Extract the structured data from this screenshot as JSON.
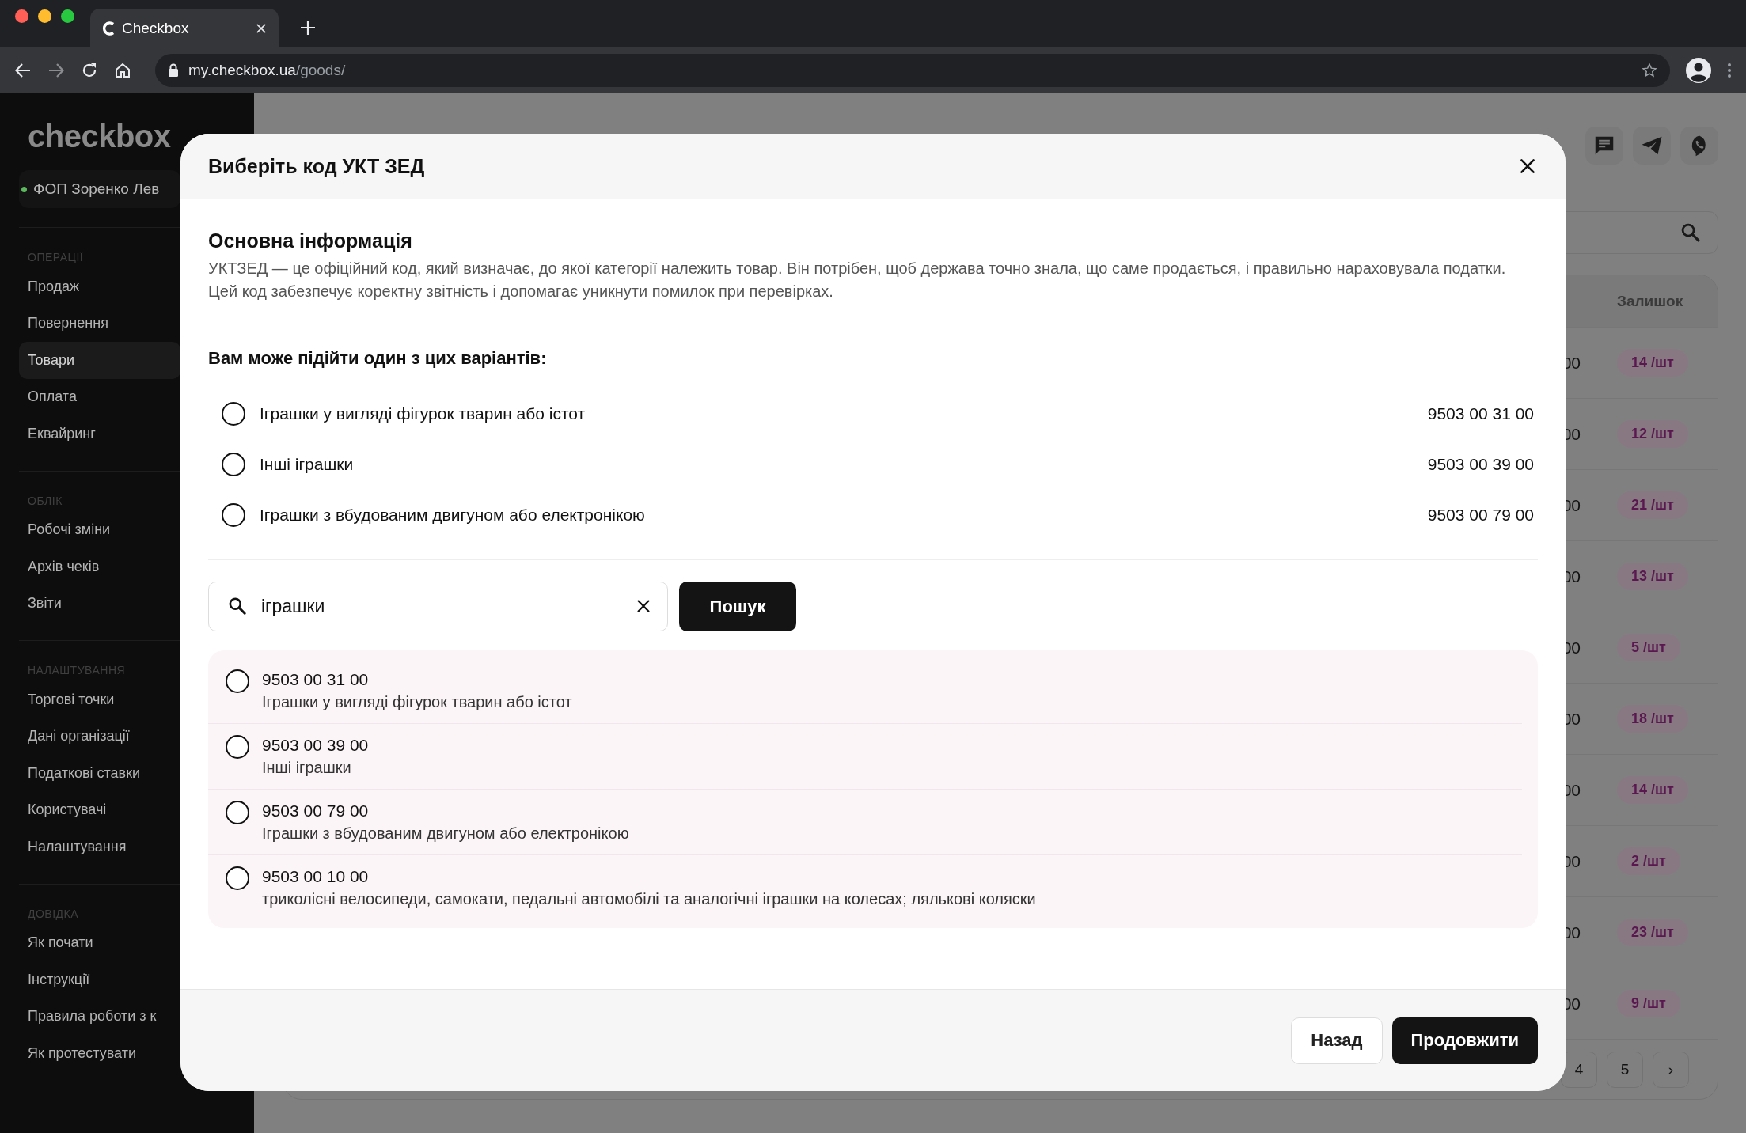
{
  "browser": {
    "tab_title": "Checkbox",
    "url_host": "my.checkbox.ua",
    "url_path": "/goods/"
  },
  "sidebar": {
    "logo": "checkbox",
    "organization": "ФОП Зоренко Лев",
    "sections": [
      {
        "title": "ОПЕРАЦІЇ",
        "items": [
          {
            "label": "Продаж",
            "selected": false
          },
          {
            "label": "Повернення",
            "selected": false
          },
          {
            "label": "Товари",
            "selected": true
          },
          {
            "label": "Оплата",
            "selected": false
          },
          {
            "label": "Еквайринг",
            "selected": false
          }
        ]
      },
      {
        "title": "ОБЛІК",
        "items": [
          {
            "label": "Робочі зміни",
            "selected": false
          },
          {
            "label": "Архів чеків",
            "selected": false
          },
          {
            "label": "Звіти",
            "selected": false
          }
        ]
      },
      {
        "title": "НАЛАШТУВАННЯ",
        "items": [
          {
            "label": "Торгові точки",
            "selected": false
          },
          {
            "label": "Дані організації",
            "selected": false
          },
          {
            "label": "Податкові ставки",
            "selected": false
          },
          {
            "label": "Користувачі",
            "selected": false
          },
          {
            "label": "Налаштування",
            "selected": false
          }
        ]
      },
      {
        "title": "ДОВІДКА",
        "items": [
          {
            "label": "Як почати",
            "selected": false
          },
          {
            "label": "Інструкції",
            "selected": false
          },
          {
            "label": "Правила роботи з к",
            "selected": false
          },
          {
            "label": "Як протестувати",
            "selected": false
          }
        ]
      }
    ]
  },
  "page": {
    "table": {
      "stock_header": "Залишок",
      "rows": [
        {
          "column_1": "00",
          "stock": "14 /шт"
        },
        {
          "column_1": "00",
          "stock": "12 /шт"
        },
        {
          "column_1": "00",
          "stock": "21 /шт"
        },
        {
          "column_1": "00",
          "stock": "13 /шт"
        },
        {
          "column_1": "00",
          "stock": "5 /шт"
        },
        {
          "column_1": "00",
          "stock": "18 /шт"
        },
        {
          "column_1": "00",
          "stock": "14 /шт"
        },
        {
          "column_1": "00",
          "stock": "2 /шт"
        },
        {
          "column_1": "00",
          "stock": "23 /шт"
        },
        {
          "column_1": "00",
          "stock": "9 /шт"
        }
      ]
    },
    "pagination": [
      "4",
      "5",
      "›"
    ]
  },
  "dialog": {
    "title": "Виберіть код УКТ ЗЕД",
    "section_title": "Основна інформація",
    "description": "УКТЗЕД — це офіційний код, який визначає, до якої категорії належить товар. Він потрібен, щоб держава точно знала, що саме продається, і правильно нараховувала податки. Цей код забезпечує коректну звітність і допомагає уникнути помилок при перевірках.",
    "suggestions_title": "Вам може підійти один з цих варіантів:",
    "suggestions": [
      {
        "name": "Іграшки у вигляді фігурок тварин або істот",
        "code": "9503 00 31 00",
        "selected": false
      },
      {
        "name": "Інші іграшки",
        "code": "9503 00 39 00",
        "selected": false
      },
      {
        "name": "Іграшки з вбудованим двигуном або електронікою",
        "code": "9503 00 79 00",
        "selected": false
      }
    ],
    "search": {
      "value": "іграшки"
    },
    "search_button": "Пошук",
    "results": [
      {
        "code": "9503 00 31 00",
        "name": "Іграшки у вигляді фігурок тварин або істот",
        "selected": false
      },
      {
        "code": "9503 00 39 00",
        "name": "Інші іграшки",
        "selected": false
      },
      {
        "code": "9503 00 79 00",
        "name": "Іграшки з вбудованим двигуном або електронікою",
        "selected": false
      },
      {
        "code": "9503 00 10 00",
        "name": "триколісні велосипеди, самокати, педальні автомобілі та аналогічні іграшки на колесах; лялькові коляски",
        "selected": false
      }
    ],
    "buttons": [
      {
        "label": "Назад",
        "kind": "secondary"
      },
      {
        "label": "Продовжити",
        "kind": "primary"
      }
    ]
  }
}
